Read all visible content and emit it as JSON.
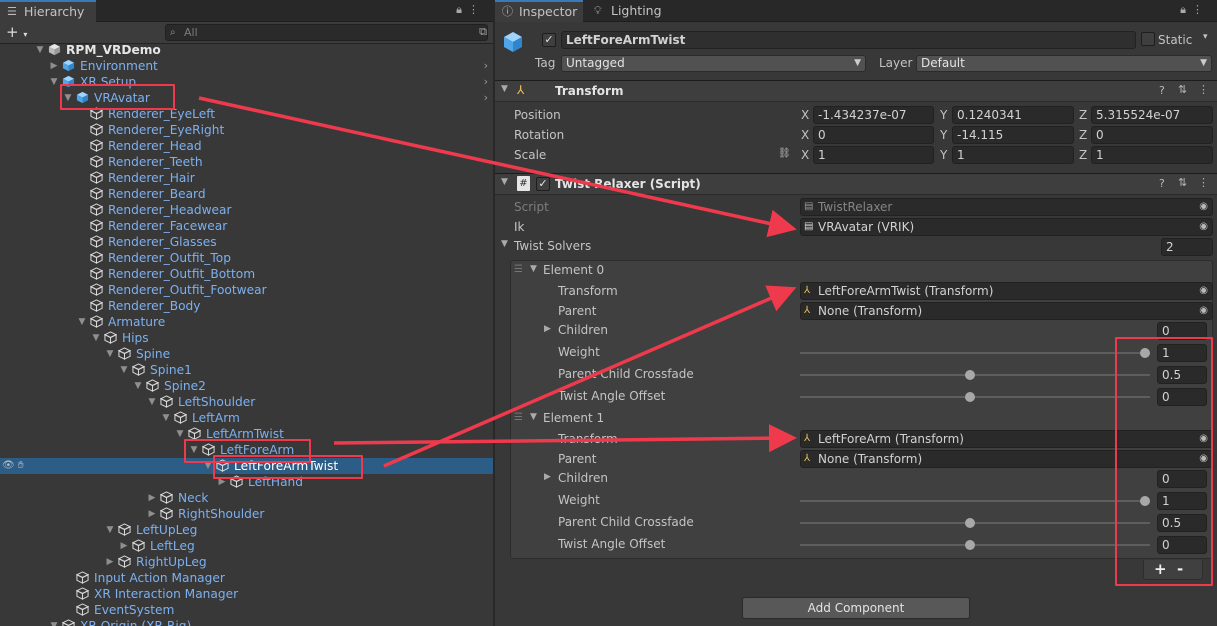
{
  "hierarchy": {
    "tab_label": "Hierarchy",
    "search_placeholder": "All",
    "rows": [
      {
        "label": "RPM_VRDemo",
        "depth": 0,
        "arrow": "down",
        "root": true
      },
      {
        "label": "Environment",
        "depth": 1,
        "arrow": "right",
        "expand": true
      },
      {
        "label": "XR Setup",
        "depth": 1,
        "arrow": "down",
        "expand": true
      },
      {
        "label": "VRAvatar",
        "depth": 2,
        "arrow": "down",
        "expand": true
      },
      {
        "label": "Renderer_EyeLeft",
        "depth": 3
      },
      {
        "label": "Renderer_EyeRight",
        "depth": 3
      },
      {
        "label": "Renderer_Head",
        "depth": 3
      },
      {
        "label": "Renderer_Teeth",
        "depth": 3
      },
      {
        "label": "Renderer_Hair",
        "depth": 3
      },
      {
        "label": "Renderer_Beard",
        "depth": 3
      },
      {
        "label": "Renderer_Headwear",
        "depth": 3
      },
      {
        "label": "Renderer_Facewear",
        "depth": 3
      },
      {
        "label": "Renderer_Glasses",
        "depth": 3
      },
      {
        "label": "Renderer_Outfit_Top",
        "depth": 3
      },
      {
        "label": "Renderer_Outfit_Bottom",
        "depth": 3
      },
      {
        "label": "Renderer_Outfit_Footwear",
        "depth": 3
      },
      {
        "label": "Renderer_Body",
        "depth": 3
      },
      {
        "label": "Armature",
        "depth": 3,
        "arrow": "down"
      },
      {
        "label": "Hips",
        "depth": 4,
        "arrow": "down"
      },
      {
        "label": "Spine",
        "depth": 5,
        "arrow": "down"
      },
      {
        "label": "Spine1",
        "depth": 6,
        "arrow": "down"
      },
      {
        "label": "Spine2",
        "depth": 7,
        "arrow": "down"
      },
      {
        "label": "LeftShoulder",
        "depth": 8,
        "arrow": "down"
      },
      {
        "label": "LeftArm",
        "depth": 9,
        "arrow": "down"
      },
      {
        "label": "LeftArmTwist",
        "depth": 10,
        "arrow": "down"
      },
      {
        "label": "LeftForeArm",
        "depth": 11,
        "arrow": "down"
      },
      {
        "label": "LeftForeArmTwist",
        "depth": 12,
        "arrow": "down",
        "selected": true
      },
      {
        "label": "LeftHand",
        "depth": 13,
        "arrow": "right"
      },
      {
        "label": "Neck",
        "depth": 8,
        "arrow": "right"
      },
      {
        "label": "RightShoulder",
        "depth": 8,
        "arrow": "right"
      },
      {
        "label": "LeftUpLeg",
        "depth": 5,
        "arrow": "down"
      },
      {
        "label": "LeftLeg",
        "depth": 6,
        "arrow": "right"
      },
      {
        "label": "RightUpLeg",
        "depth": 5,
        "arrow": "right"
      },
      {
        "label": "Input Action Manager",
        "depth": 2
      },
      {
        "label": "XR Interaction Manager",
        "depth": 2
      },
      {
        "label": "EventSystem",
        "depth": 2
      },
      {
        "label": "XR Origin (XR Rig)",
        "depth": 1,
        "arrow": "down"
      }
    ]
  },
  "inspector": {
    "tab_label": "Inspector",
    "lighting_tab_label": "Lighting",
    "object_name": "LeftForeArmTwist",
    "static_label": "Static",
    "tag_label": "Tag",
    "tag_value": "Untagged",
    "layer_label": "Layer",
    "layer_value": "Default",
    "transform": {
      "title": "Transform",
      "position_label": "Position",
      "rotation_label": "Rotation",
      "scale_label": "Scale",
      "x_label": "X",
      "y_label": "Y",
      "z_label": "Z",
      "position": {
        "x": "-1.434237e-07",
        "y": "0.1240341",
        "z": "5.315524e-07"
      },
      "rotation": {
        "x": "0",
        "y": "-14.115",
        "z": "0"
      },
      "scale": {
        "x": "1",
        "y": "1",
        "z": "1"
      }
    },
    "twist": {
      "title": "Twist Relaxer (Script)",
      "script_label": "Script",
      "script_value": "TwistRelaxer",
      "ik_label": "Ik",
      "ik_value": "VRAvatar (VRIK)",
      "solvers_label": "Twist Solvers",
      "solvers_count": "2",
      "elements": [
        {
          "label": "Element 0",
          "transform_label": "Transform",
          "transform_value": "LeftForeArmTwist (Transform)",
          "parent_label": "Parent",
          "parent_value": "None (Transform)",
          "children_label": "Children",
          "children_value": "0",
          "weight_label": "Weight",
          "weight_value": "1",
          "crossfade_label": "Parent Child Crossfade",
          "crossfade_value": "0.5",
          "angle_label": "Twist Angle Offset",
          "angle_value": "0"
        },
        {
          "label": "Element 1",
          "transform_label": "Transform",
          "transform_value": "LeftForeArm (Transform)",
          "parent_label": "Parent",
          "parent_value": "None (Transform)",
          "children_label": "Children",
          "children_value": "0",
          "weight_label": "Weight",
          "weight_value": "1",
          "crossfade_label": "Parent Child Crossfade",
          "crossfade_value": "0.5",
          "angle_label": "Twist Angle Offset",
          "angle_value": "0"
        }
      ],
      "add_symbol": "+",
      "remove_symbol": "-"
    },
    "add_component_label": "Add Component"
  },
  "colors": {
    "selection": "#2c5d87",
    "annotation": "#ee3a4c",
    "prefab_blue": "#7cb0f0"
  }
}
